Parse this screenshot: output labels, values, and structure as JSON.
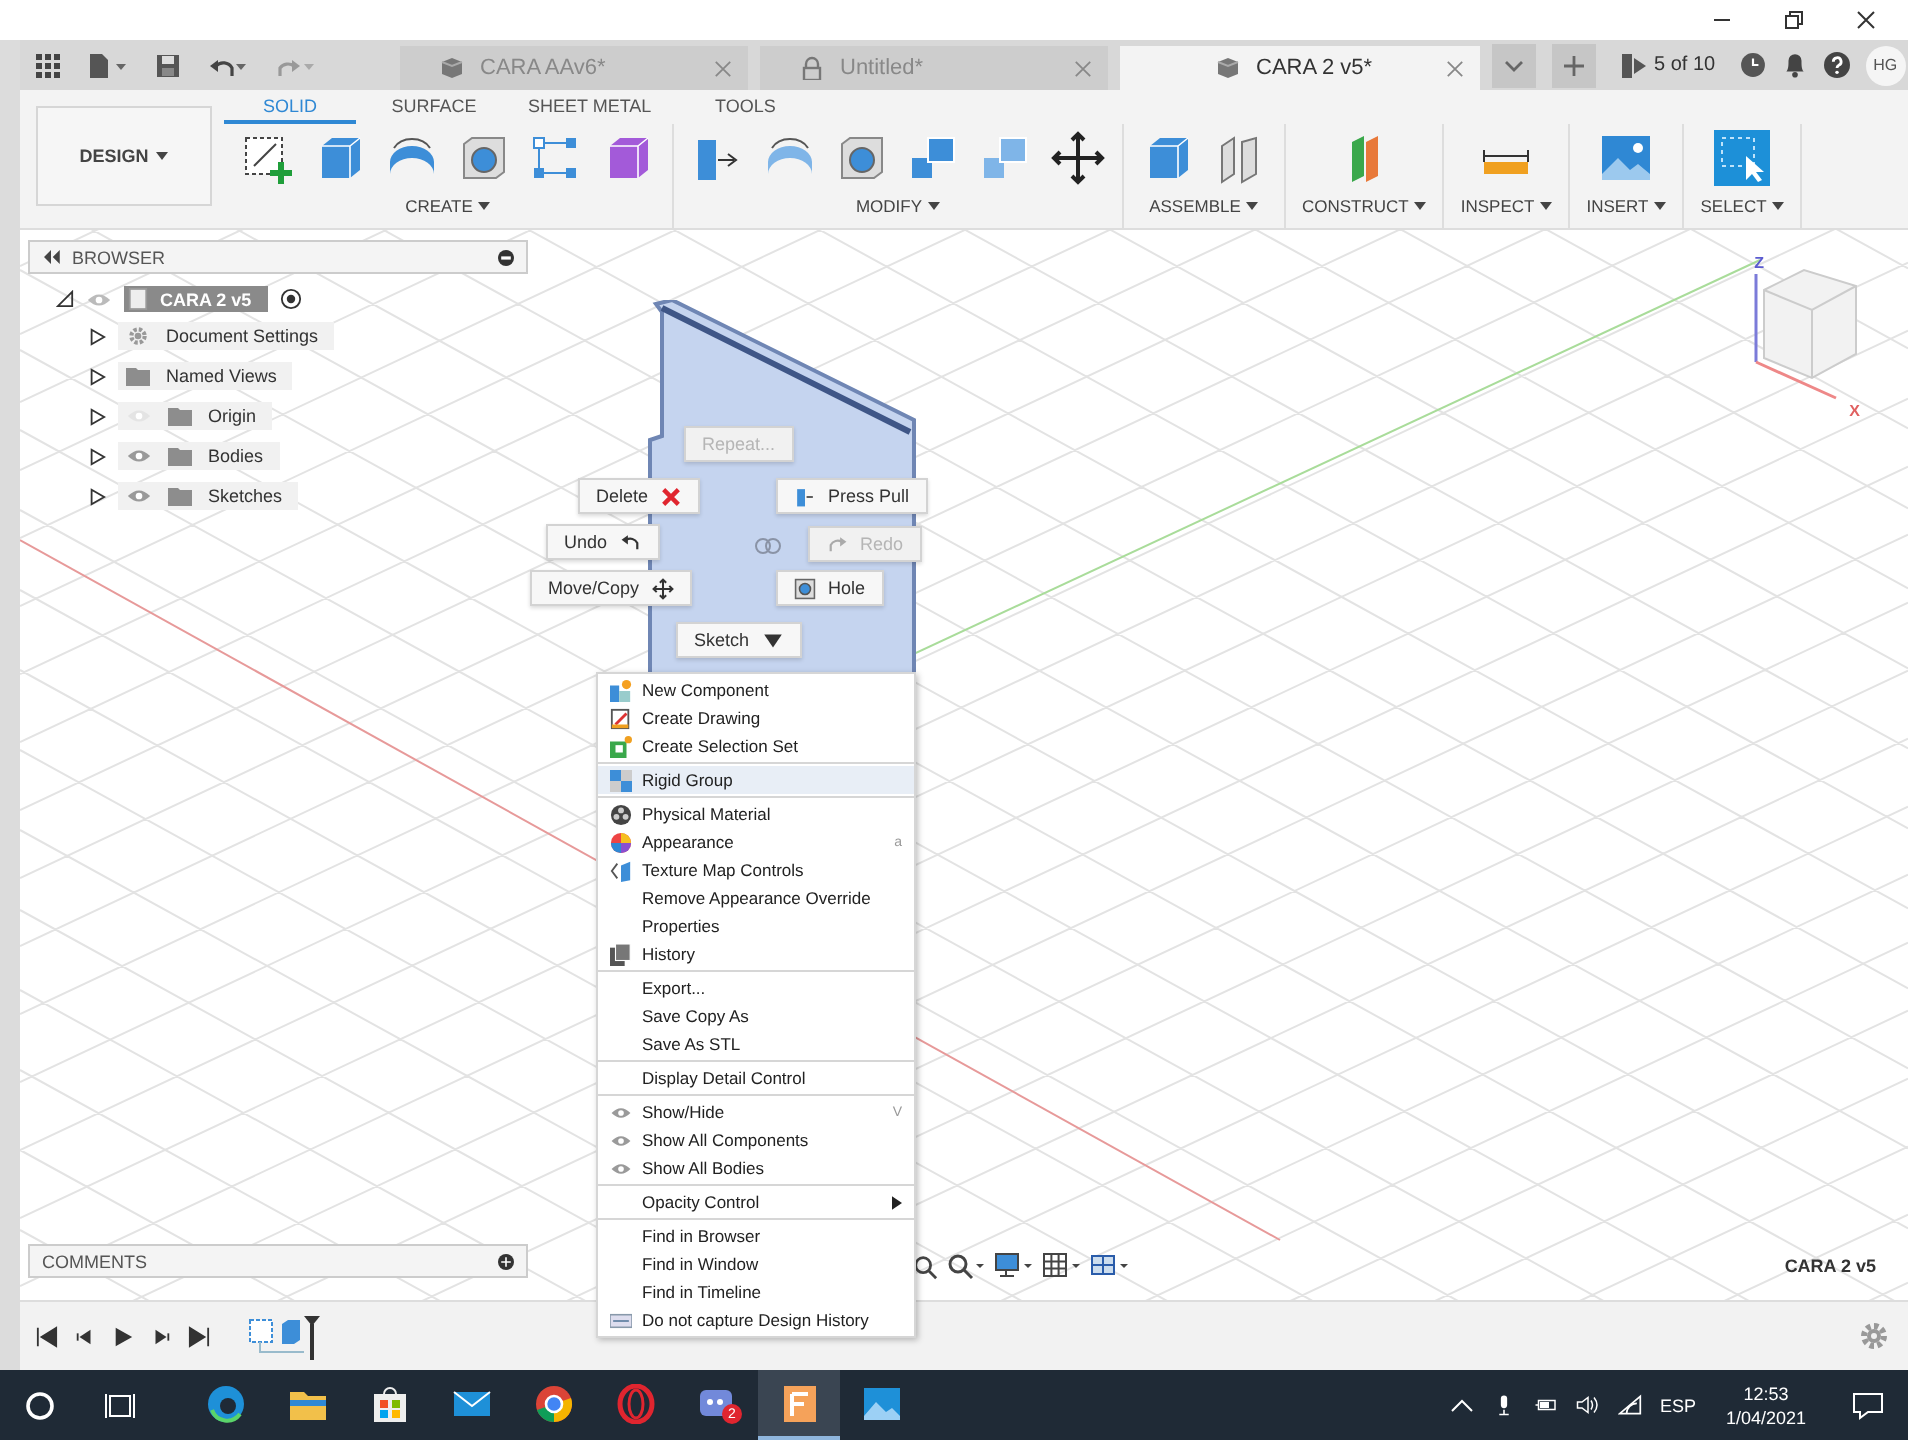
{
  "tabs": [
    {
      "title": "CARA  AAv6*",
      "selected": false,
      "locked": false
    },
    {
      "title": "Untitled*",
      "selected": false,
      "locked": true
    },
    {
      "title": "CARA 2 v5*",
      "selected": true,
      "locked": false
    }
  ],
  "job_status": "5 of 10",
  "user_initials": "HG",
  "ribbon": {
    "workspace": "DESIGN",
    "tabs": [
      {
        "label": "SOLID",
        "selected": true
      },
      {
        "label": "SURFACE",
        "selected": false
      },
      {
        "label": "SHEET METAL",
        "selected": false
      },
      {
        "label": "TOOLS",
        "selected": false
      }
    ],
    "groups": [
      {
        "label": "CREATE",
        "tools": [
          {
            "kind": "sketch"
          },
          {
            "kind": "extrude"
          },
          {
            "kind": "sweep"
          },
          {
            "kind": "hole"
          },
          {
            "kind": "pattern"
          },
          {
            "kind": "form"
          }
        ]
      },
      {
        "label": "MODIFY",
        "tools": [
          {
            "kind": "press-pull"
          },
          {
            "kind": "fillet"
          },
          {
            "kind": "shell"
          },
          {
            "kind": "combine"
          },
          {
            "kind": "split"
          },
          {
            "kind": "move"
          }
        ]
      },
      {
        "label": "ASSEMBLE",
        "tools": [
          {
            "kind": "component"
          },
          {
            "kind": "joint"
          }
        ]
      },
      {
        "label": "CONSTRUCT",
        "tools": [
          {
            "kind": "plane"
          }
        ]
      },
      {
        "label": "INSPECT",
        "tools": [
          {
            "kind": "measure"
          }
        ]
      },
      {
        "label": "INSERT",
        "tools": [
          {
            "kind": "image"
          }
        ]
      },
      {
        "label": "SELECT",
        "tools": [
          {
            "kind": "select"
          }
        ]
      }
    ]
  },
  "browser": {
    "title": "BROWSER",
    "root": {
      "label": "CARA 2 v5",
      "expanded": true,
      "children": [
        {
          "label": "Document Settings",
          "kind": "settings",
          "expanded": false
        },
        {
          "label": "Named Views",
          "kind": "views",
          "expanded": false
        },
        {
          "label": "Origin",
          "kind": "folder",
          "visible": false,
          "expanded": false
        },
        {
          "label": "Bodies",
          "kind": "folder",
          "visible": true,
          "expanded": false
        },
        {
          "label": "Sketches",
          "kind": "folder",
          "visible": true,
          "expanded": false
        }
      ]
    }
  },
  "marking_menu": [
    {
      "label": "Repeat...",
      "kind": "none",
      "disabled": true
    },
    {
      "label": "Delete",
      "kind": "delete",
      "disabled": false
    },
    {
      "label": "Press Pull",
      "kind": "press-pull",
      "disabled": false
    },
    {
      "label": "Undo",
      "kind": "undo",
      "disabled": false
    },
    {
      "label": "Redo",
      "kind": "redo",
      "disabled": true
    },
    {
      "label": "Move/Copy",
      "kind": "move",
      "disabled": false
    },
    {
      "label": "Hole",
      "kind": "hole",
      "disabled": false
    },
    {
      "label": "Sketch",
      "kind": "dropdown",
      "disabled": false
    }
  ],
  "context_menu": [
    [
      {
        "label": "New Component",
        "kind": "component"
      },
      {
        "label": "Create Drawing",
        "kind": "drawing"
      },
      {
        "label": "Create Selection Set",
        "kind": "selection-set"
      }
    ],
    [
      {
        "label": "Rigid Group",
        "kind": "rigid-group"
      }
    ],
    [
      {
        "label": "Physical Material",
        "kind": "material"
      },
      {
        "label": "Appearance",
        "kind": "appearance",
        "shortcut": "a"
      },
      {
        "label": "Texture Map Controls",
        "kind": "texture"
      },
      {
        "label": "Remove Appearance Override",
        "kind": "none"
      },
      {
        "label": "Properties",
        "kind": "none"
      },
      {
        "label": "History",
        "kind": "history"
      }
    ],
    [
      {
        "label": "Export...",
        "kind": "none"
      },
      {
        "label": "Save Copy As",
        "kind": "none"
      },
      {
        "label": "Save As STL",
        "kind": "none"
      }
    ],
    [
      {
        "label": "Display Detail Control",
        "kind": "none"
      }
    ],
    [
      {
        "label": "Show/Hide",
        "kind": "eye",
        "shortcut": "V"
      },
      {
        "label": "Show All Components",
        "kind": "eye"
      },
      {
        "label": "Show All Bodies",
        "kind": "eye"
      }
    ],
    [
      {
        "label": "Opacity Control",
        "kind": "none",
        "submenu": true
      }
    ],
    [
      {
        "label": "Find in Browser",
        "kind": "none"
      },
      {
        "label": "Find in Window",
        "kind": "none"
      },
      {
        "label": "Find in Timeline",
        "kind": "none"
      },
      {
        "label": "Do not capture Design History",
        "kind": "capture"
      }
    ]
  ],
  "viewcube": {
    "axes": [
      "Z",
      "X"
    ]
  },
  "comments": {
    "title": "COMMENTS"
  },
  "document_name": "CARA 2 v5",
  "taskbar": {
    "apps": [
      {
        "kind": "edge",
        "active": false
      },
      {
        "kind": "explorer",
        "active": false
      },
      {
        "kind": "store",
        "active": false
      },
      {
        "kind": "mail",
        "active": false
      },
      {
        "kind": "chrome",
        "active": false
      },
      {
        "kind": "opera",
        "active": false
      },
      {
        "kind": "chat",
        "active": false,
        "badge": "2"
      },
      {
        "kind": "fusion",
        "active": true
      },
      {
        "kind": "photos",
        "active": false
      }
    ],
    "language": "ESP",
    "time": "12:53",
    "date": "1/04/2021"
  }
}
